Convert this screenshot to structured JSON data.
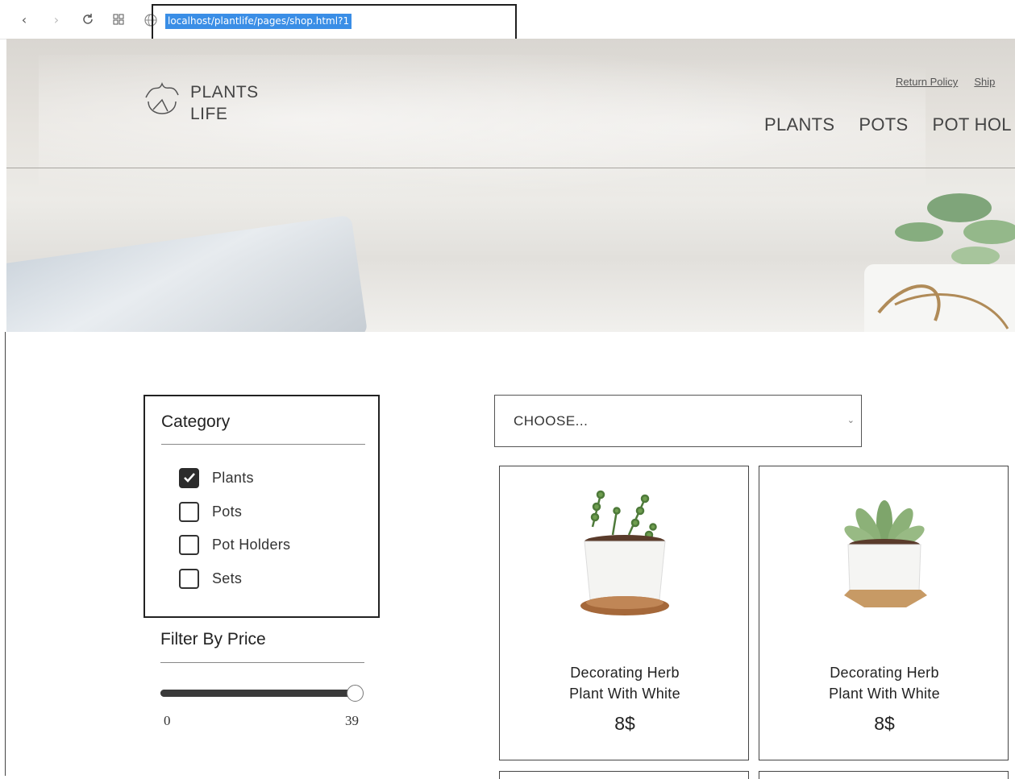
{
  "browser": {
    "url": "localhost/plantlife/pages/shop.html?1",
    "icons": [
      "back-icon",
      "forward-icon",
      "reload-icon",
      "tabs-grid-icon",
      "globe-icon"
    ]
  },
  "header": {
    "logo_line1": "PLANTS",
    "logo_line2": "LIFE",
    "top_links": [
      "Return Policy",
      "Ship"
    ],
    "nav": [
      "PLANTS",
      "POTS",
      "POT HOL"
    ]
  },
  "sidebar": {
    "category_heading": "Category",
    "categories": [
      {
        "label": "Plants",
        "checked": true
      },
      {
        "label": "Pots",
        "checked": false
      },
      {
        "label": "Pot Holders",
        "checked": false
      },
      {
        "label": "Sets",
        "checked": false
      }
    ],
    "price_heading": "Filter By Price",
    "price_min": "0",
    "price_max": "39",
    "price_level": 1.0
  },
  "sort": {
    "selected": "CHOOSE..."
  },
  "products": [
    {
      "title_line1": "Decorating Herb",
      "title_line2": "Plant With White",
      "price": "8$"
    },
    {
      "title_line1": "Decorating Herb",
      "title_line2": "Plant With White",
      "price": "8$"
    }
  ],
  "colors": {
    "selection": "#3a8ee6",
    "text": "#222222",
    "checkbox_checked": "#2b2b2b",
    "border": "#444444"
  }
}
